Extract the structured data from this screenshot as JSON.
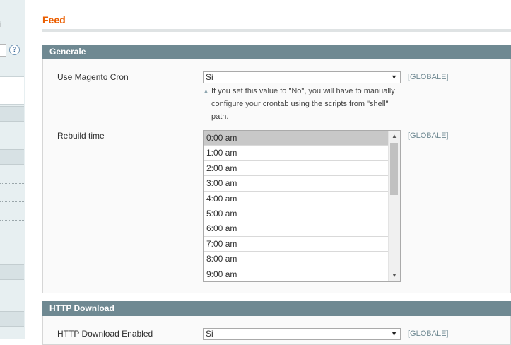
{
  "sidebar": {
    "fragment_text": "i",
    "help_icon": "?"
  },
  "page": {
    "title": "Feed"
  },
  "sections": {
    "generale": {
      "title": "Generale",
      "use_cron": {
        "label": "Use Magento Cron",
        "value": "Si",
        "scope": "[GLOBALE]",
        "note_line1": "If you set this value to \"No\", you will have to manually",
        "note_line2": "configure your crontab using the scripts from \"shell\"",
        "note_line3": "path."
      },
      "rebuild_time": {
        "label": "Rebuild time",
        "scope": "[GLOBALE]",
        "options": [
          "0:00 am",
          "1:00 am",
          "2:00 am",
          "3:00 am",
          "4:00 am",
          "5:00 am",
          "6:00 am",
          "7:00 am",
          "8:00 am",
          "9:00 am"
        ],
        "selected": "0:00 am"
      }
    },
    "http_download": {
      "title": "HTTP Download",
      "enabled": {
        "label": "HTTP Download Enabled",
        "value": "Si",
        "scope": "[GLOBALE]"
      }
    }
  },
  "icons": {
    "dropdown": "chevron-down-icon",
    "note": "triangle-up-icon",
    "help": "help-icon"
  },
  "colors": {
    "title": "#eb5e00",
    "section_header": "#6f8992",
    "scope": "#6f8992"
  }
}
